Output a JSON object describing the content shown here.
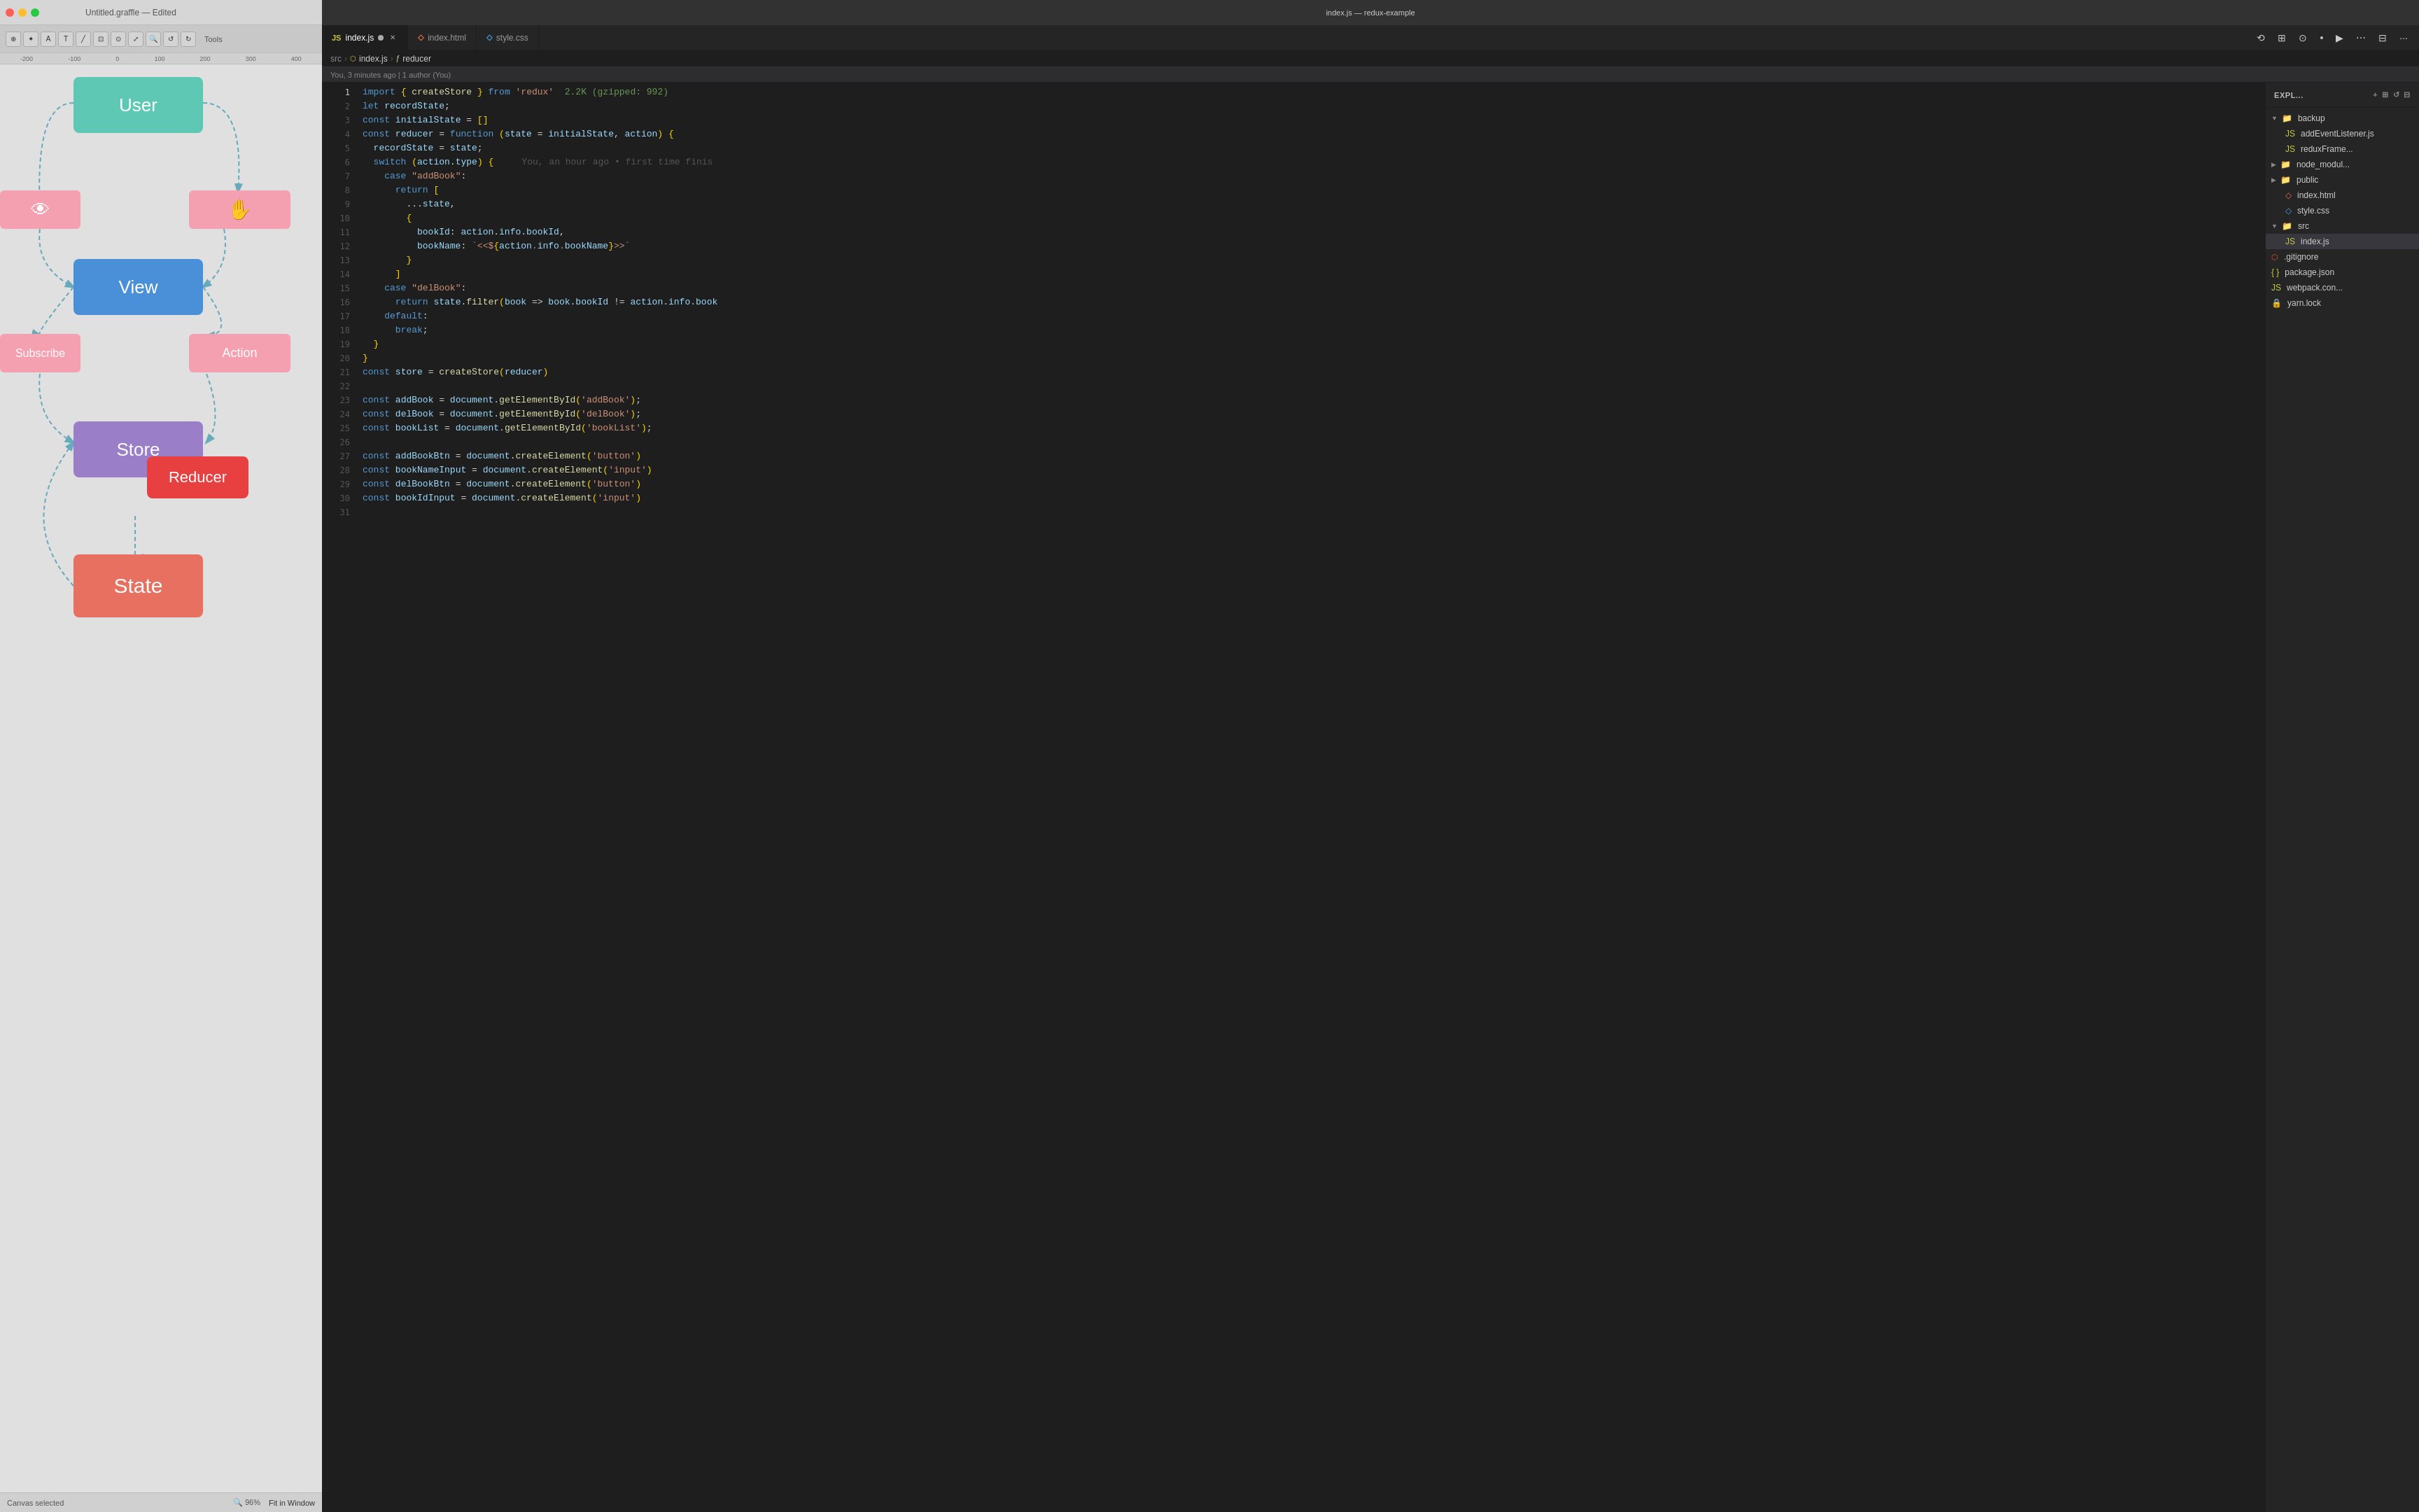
{
  "graffle": {
    "title": "Untitled.graffle — Edited",
    "status": "Canvas selected",
    "zoom": "96%",
    "fit_label": "Fit in Window",
    "nodes": {
      "user": "User",
      "view": "View",
      "store": "Store",
      "reducer": "Reducer",
      "state": "State",
      "subscribe": "Subscribe",
      "action": "Action"
    }
  },
  "vscode": {
    "title": "index.js — redux-example",
    "tabs": [
      {
        "id": "index-js",
        "label": "index.js",
        "type": "js",
        "modified": true,
        "active": true
      },
      {
        "id": "index-html",
        "label": "index.html",
        "type": "html",
        "modified": false,
        "active": false
      },
      {
        "id": "style-css",
        "label": "style.css",
        "type": "css",
        "modified": false,
        "active": false
      }
    ],
    "breadcrumb": {
      "src": "src",
      "file": "index.js",
      "symbol": "reducer"
    },
    "git_blame": "You, 3 minutes ago | 1 author (You)",
    "explorer_header": "EXPL...",
    "file_tree": [
      {
        "indent": 0,
        "type": "folder",
        "arrow": "▼",
        "name": "backup"
      },
      {
        "indent": 1,
        "type": "file-js",
        "name": "addEventListener.js"
      },
      {
        "indent": 1,
        "type": "file-js",
        "name": "reduxFrame..."
      },
      {
        "indent": 0,
        "type": "folder",
        "arrow": "▶",
        "name": "node_modul..."
      },
      {
        "indent": 0,
        "type": "folder",
        "arrow": "▶",
        "name": "public"
      },
      {
        "indent": 1,
        "type": "file-html",
        "name": "index.html"
      },
      {
        "indent": 1,
        "type": "file-css",
        "name": "style.css"
      },
      {
        "indent": 0,
        "type": "folder",
        "arrow": "▼",
        "name": "src"
      },
      {
        "indent": 1,
        "type": "file-js",
        "name": "index.js",
        "selected": true
      },
      {
        "indent": 0,
        "type": "file-git",
        "name": ".gitignore"
      },
      {
        "indent": 0,
        "type": "file-json",
        "name": "package.json"
      },
      {
        "indent": 0,
        "type": "file-js",
        "name": "webpack.con..."
      },
      {
        "indent": 0,
        "type": "file-lock",
        "name": "yarn.lock"
      }
    ],
    "code": [
      {
        "num": 1,
        "text": "import { createStore } from 'redux'  2.2K (gzipped: 992)"
      },
      {
        "num": 2,
        "text": "let recordState;"
      },
      {
        "num": 3,
        "text": "const initialState = []"
      },
      {
        "num": 4,
        "text": "const reducer = function (state = initialState, action) {"
      },
      {
        "num": 5,
        "text": "  recordState = state;"
      },
      {
        "num": 6,
        "text": "  switch (action.type) {",
        "blame": "You, an hour ago • first time finis"
      },
      {
        "num": 7,
        "text": "    case \"addBook\":"
      },
      {
        "num": 8,
        "text": "      return ["
      },
      {
        "num": 9,
        "text": "        ...state,"
      },
      {
        "num": 10,
        "text": "        {"
      },
      {
        "num": 11,
        "text": "          bookId: action.info.bookId,"
      },
      {
        "num": 12,
        "text": "          bookName: `<<${action.info.bookName}>>`"
      },
      {
        "num": 13,
        "text": "        }"
      },
      {
        "num": 14,
        "text": "      ]"
      },
      {
        "num": 15,
        "text": "    case \"delBook\":"
      },
      {
        "num": 16,
        "text": "      return state.filter(book => book.bookId != action.info.book"
      },
      {
        "num": 17,
        "text": "    default:"
      },
      {
        "num": 18,
        "text": "      break;"
      },
      {
        "num": 19,
        "text": "  }"
      },
      {
        "num": 20,
        "text": "}"
      },
      {
        "num": 21,
        "text": "const store = createStore(reducer)"
      },
      {
        "num": 22,
        "text": ""
      },
      {
        "num": 23,
        "text": "const addBook = document.getElementById('addBook');"
      },
      {
        "num": 24,
        "text": "const delBook = document.getElementById('delBook');"
      },
      {
        "num": 25,
        "text": "const bookList = document.getElementById('bookList');"
      },
      {
        "num": 26,
        "text": ""
      },
      {
        "num": 27,
        "text": "const addBookBtn = document.createElement('button')"
      },
      {
        "num": 28,
        "text": "const bookNameInput = document.createElement('input')"
      },
      {
        "num": 29,
        "text": "const delBookBtn = document.createElement('button')"
      },
      {
        "num": 30,
        "text": "const bookIdInput = document.createElement('input')"
      },
      {
        "num": 31,
        "text": ""
      }
    ]
  }
}
